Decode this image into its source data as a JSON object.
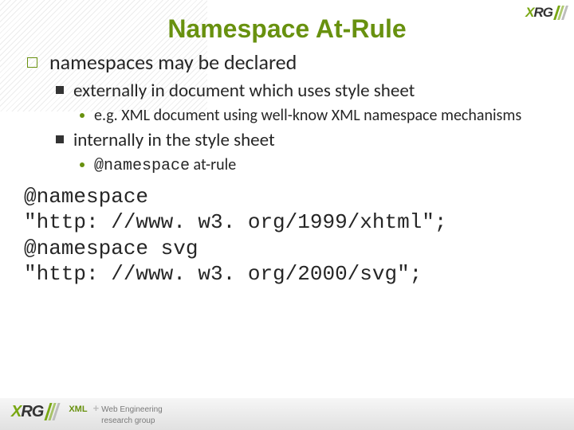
{
  "logo": {
    "text_x": "X",
    "text_rg": "RG"
  },
  "title": "Namespace At-Rule",
  "bullets": {
    "l1": "namespaces may be declared",
    "l2a": "externally in document which uses style sheet",
    "l3a": "e.g. XML document using well-know XML namespace mechanisms",
    "l2b": "internally in the style sheet",
    "l3b_code": "@namespace",
    "l3b_tail": " at-rule"
  },
  "code": "@namespace\n\"http: //www. w3. org/1999/xhtml\";\n@namespace svg\n\"http: //www. w3. org/2000/svg\";",
  "footer": {
    "xml": "XML",
    "line1": "Web Engineering",
    "line2": "research group"
  }
}
